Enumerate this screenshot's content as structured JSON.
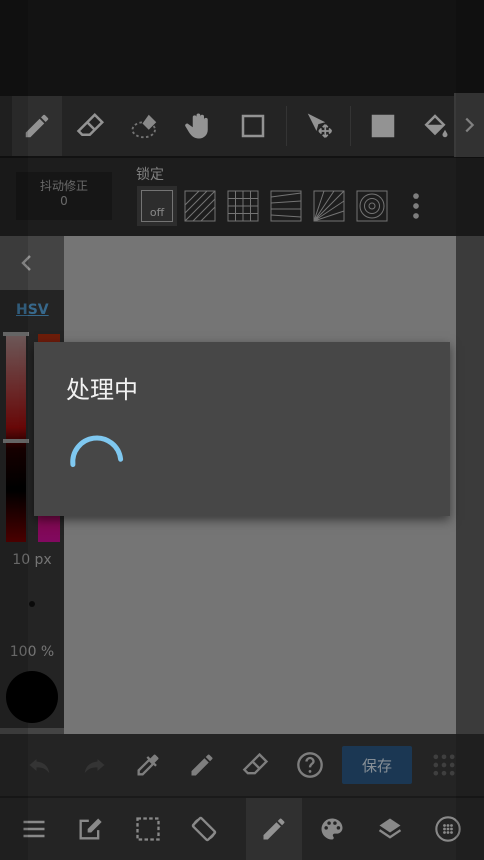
{
  "stabilizer": {
    "label": "抖动修正",
    "value": "0"
  },
  "lock": {
    "title": "锁定",
    "off_label": "off"
  },
  "side_panel": {
    "mode": "HSV",
    "size": "10 px",
    "opacity": "100 %"
  },
  "dialog": {
    "title": "处理中"
  },
  "bottom": {
    "save_label": "保存"
  },
  "colors": {
    "accent": "#5aa8e0",
    "save": "#2c5a86",
    "spinner": "#7fc8f0"
  }
}
